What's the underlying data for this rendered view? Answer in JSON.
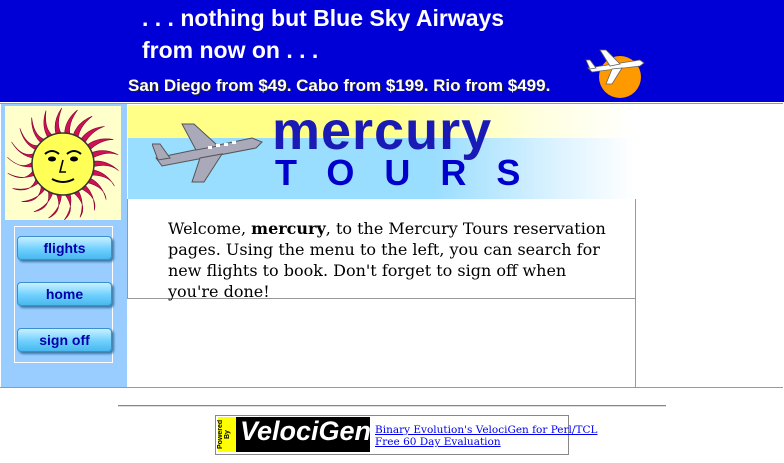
{
  "banner": {
    "tagline_line1": ". . . nothing but Blue Sky Airways",
    "tagline_line2": "from now on . . .",
    "promo": "San Diego from $49. Cabo from $199. Rio from $499."
  },
  "header": {
    "title_word1": "mercury",
    "title_word2": "TOURS"
  },
  "sidebar": {
    "items": [
      {
        "label": "flights"
      },
      {
        "label": "home"
      },
      {
        "label": "sign off"
      }
    ]
  },
  "main": {
    "welcome_prefix": "Welcome, ",
    "username": "mercury",
    "welcome_suffix": ", to the Mercury Tours reservation pages. Using the menu to the left, you can search for new flights to book. Don't forget to sign off when you're done!"
  },
  "footer": {
    "powered_text": "Powered By",
    "logo_text": "VelociGen!",
    "link1": "Binary Evolution's VelociGen for Perl/TCL",
    "link2": "Free 60 Day Evaluation"
  },
  "colors": {
    "banner_bg": "#0000d6",
    "sidebar_bg": "#99ccff",
    "header_yellow": "#ffff88",
    "header_blue": "#99ddff",
    "title_blue": "#1a1ab5",
    "sun_face": "#ffff55",
    "sun_rays": "#cc1155"
  },
  "icons": {
    "banner_plane": "plane-over-sun-icon",
    "sun": "sun-face-icon",
    "header_plane": "airplane-icon"
  }
}
